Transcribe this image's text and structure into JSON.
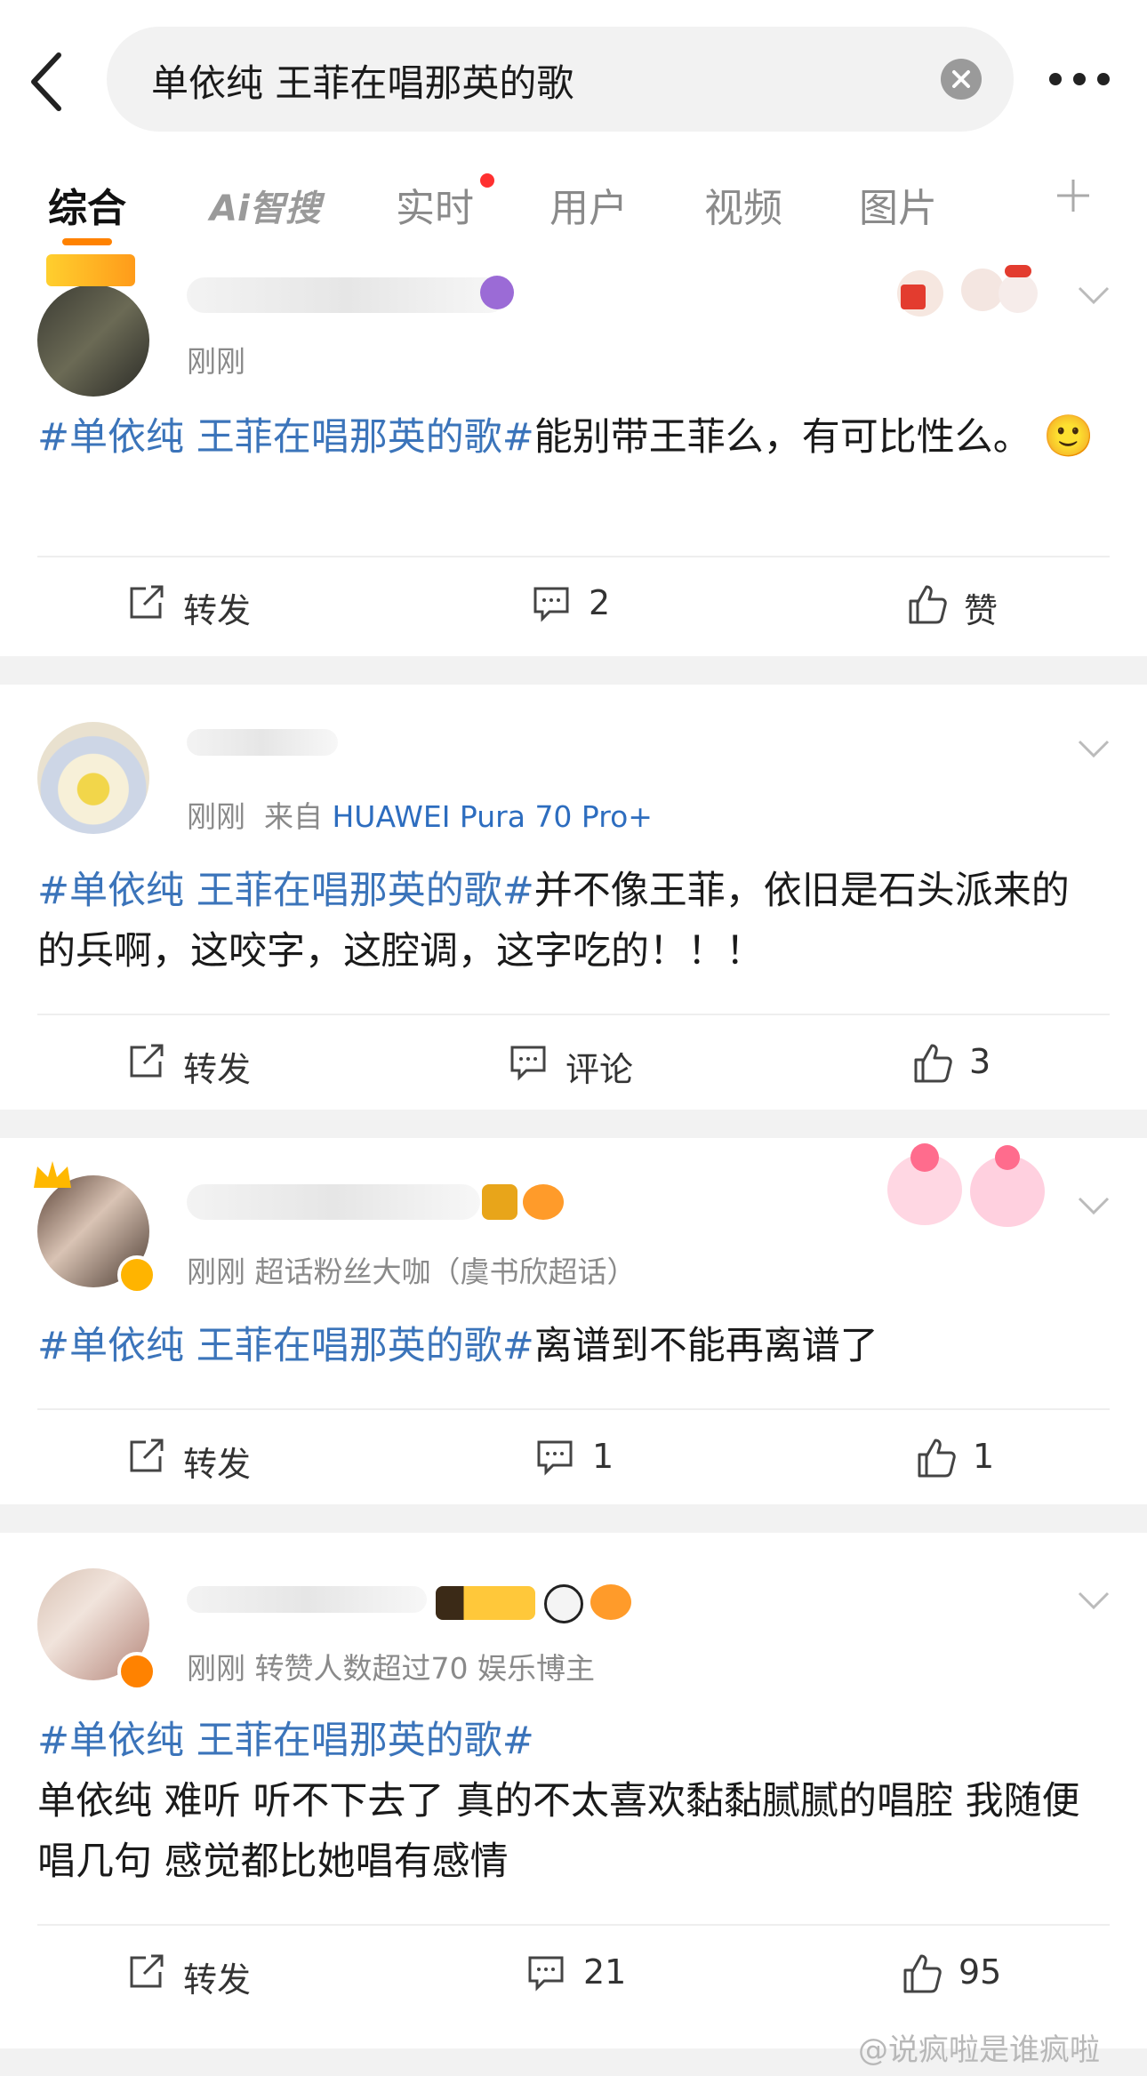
{
  "search": {
    "query": "单依纯 王菲在唱那英的歌"
  },
  "tabs": [
    {
      "label": "综合",
      "active": true
    },
    {
      "label": "Ai智搜"
    },
    {
      "label": "实时",
      "has_dot": true
    },
    {
      "label": "用户"
    },
    {
      "label": "视频"
    },
    {
      "label": "图片"
    }
  ],
  "posts": [
    {
      "meta": "刚刚",
      "hashtag": "#单依纯 王菲在唱那英的歌#",
      "body": "能别带王菲么，有可比性么。",
      "emoji": "🙂",
      "repost": "转发",
      "comment": "2",
      "like": "赞"
    },
    {
      "meta_time": "刚刚",
      "meta_from": "来自",
      "meta_source": "HUAWEI Pura 70 Pro+",
      "hashtag": "#单依纯 王菲在唱那英的歌#",
      "body": "并不像王菲，依旧是石头派来的的兵啊，这咬字，这腔调，这字吃的！！！",
      "repost": "转发",
      "comment": "评论",
      "like": "3"
    },
    {
      "meta": "刚刚  超话粉丝大咖（虞书欣超话）",
      "hashtag": "#单依纯 王菲在唱那英的歌#",
      "body": "离谱到不能再离谱了",
      "repost": "转发",
      "comment": "1",
      "like": "1"
    },
    {
      "meta": "刚刚 转赞人数超过70  娱乐博主",
      "hashtag": "#单依纯 王菲在唱那英的歌#",
      "body": "单依纯 难听 听不下去了 真的不太喜欢黏黏腻腻的唱腔 我随便唱几句 感觉都比她唱有感情",
      "repost": "转发",
      "comment": "21",
      "like": "95"
    }
  ],
  "watermark": "@说疯啦是谁疯啦",
  "colors": {
    "accent": "#ff8200",
    "link": "#3b74ba",
    "badge": "#ffb400"
  }
}
